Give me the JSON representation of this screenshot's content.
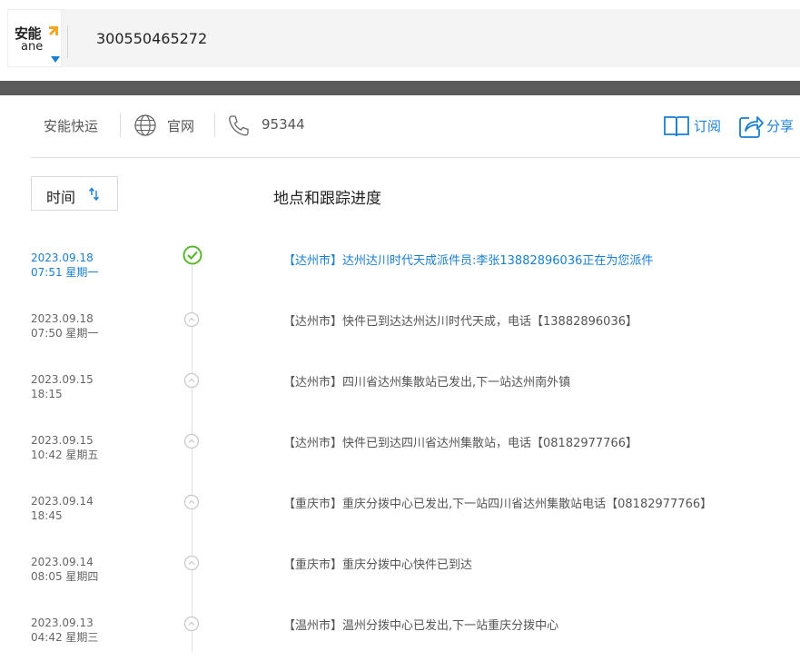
{
  "header": {
    "logo_text_cn": "安能",
    "logo_text_en": "ane",
    "tracking_number": "300550465272"
  },
  "info": {
    "company": "安能快运",
    "website_label": "官网",
    "phone": "95344",
    "subscribe_label": "订阅",
    "share_label": "分享"
  },
  "table": {
    "time_label": "时间",
    "progress_label": "地点和跟踪进度"
  },
  "events": [
    {
      "date": "2023.09.18",
      "time": "07:51 星期一",
      "text": "【达州市】达州达川时代天成派件员:李张13882896036正在为您派件",
      "active": true
    },
    {
      "date": "2023.09.18",
      "time": "07:50 星期一",
      "text": "【达州市】快件已到达达州达川时代天成，电话【13882896036】",
      "active": false
    },
    {
      "date": "2023.09.15",
      "time": "18:15",
      "text": "【达州市】四川省达州集散站已发出,下一站达州南外镇",
      "active": false
    },
    {
      "date": "2023.09.15",
      "time": "10:42 星期五",
      "text": "【达州市】快件已到达四川省达州集散站，电话【08182977766】",
      "active": false
    },
    {
      "date": "2023.09.14",
      "time": "18:45",
      "text": "【重庆市】重庆分拨中心已发出,下一站四川省达州集散站电话【08182977766】",
      "active": false
    },
    {
      "date": "2023.09.14",
      "time": "08:05 星期四",
      "text": "【重庆市】重庆分拨中心快件已到达",
      "active": false
    },
    {
      "date": "2023.09.13",
      "time": "04:42 星期三",
      "text": "【温州市】温州分拨中心已发出,下一站重庆分拨中心",
      "active": false
    }
  ],
  "colors": {
    "accent": "#1a7fd4",
    "check": "#5ab82e",
    "logo_orange": "#f5a623"
  }
}
